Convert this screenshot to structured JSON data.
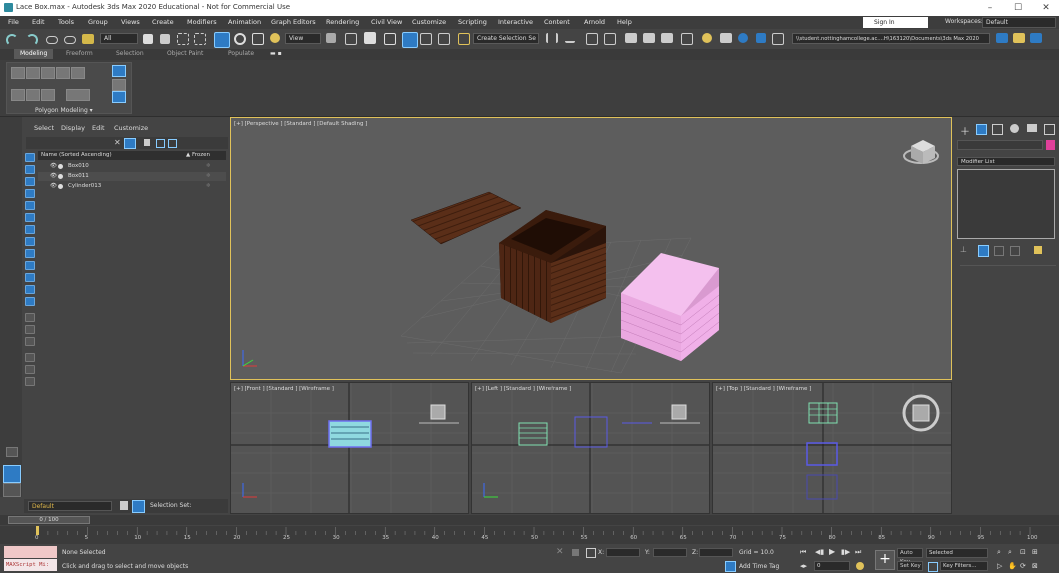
{
  "window": {
    "title": "Lace Box.max - Autodesk 3ds Max 2020 Educational - Not for Commercial Use",
    "min": "–",
    "max": "☐",
    "close": "✕"
  },
  "menu": [
    "File",
    "Edit",
    "Tools",
    "Group",
    "Views",
    "Create",
    "Modifiers",
    "Animation",
    "Graph Editors",
    "Rendering",
    "Civil View",
    "Customize",
    "Scripting",
    "Interactive",
    "Content",
    "Arnold",
    "Help"
  ],
  "account": {
    "signin": "Sign In",
    "workspaces_label": "Workspaces:",
    "workspace": "Default"
  },
  "toolbar": {
    "filter": "All",
    "view": "View",
    "selection_set": "Create Selection Se",
    "path": "\\\\student.nottinghamcollege.ac....H\\163120\\Documents\\3ds Max 2020"
  },
  "ribbon": {
    "tabs": [
      "Modeling",
      "Freeform",
      "Selection",
      "Object Paint",
      "Populate"
    ],
    "panel_label": "Polygon Modeling ▾"
  },
  "explorer": {
    "menu": [
      "Select",
      "Display",
      "Edit",
      "Customize"
    ],
    "col_name": "Name (Sorted Ascending)",
    "col_frozen": "▲ Frozen",
    "rows": [
      {
        "name": "Box010"
      },
      {
        "name": "Box011"
      },
      {
        "name": "Cylinder013"
      }
    ]
  },
  "layer": {
    "name": "Default",
    "selset_label": "Selection Set:"
  },
  "viewports": {
    "perspective": "[+] [Perspective ] [Standard ] [Default Shading ]",
    "front": "[+] [Front ] [Standard ] [Wireframe ]",
    "left": "[+] [Left ] [Standard ] [Wireframe ]",
    "top": "[+] [Top ] [Standard ] [Wireframe ]"
  },
  "cmdpanel": {
    "modifier_list": "Modifier List"
  },
  "timeline": {
    "frame": "0 / 100",
    "ticks": [
      "0",
      "5",
      "10",
      "15",
      "20",
      "25",
      "30",
      "35",
      "40",
      "45",
      "50",
      "55",
      "60",
      "65",
      "70",
      "75",
      "80",
      "85",
      "90",
      "95",
      "100"
    ]
  },
  "status": {
    "maxscript": "MAXScript Mi:",
    "selection": "None Selected",
    "prompt": "Click and drag to select and move objects",
    "x_label": "X:",
    "y_label": "Y:",
    "z_label": "Z:",
    "grid": "Grid = 10.0",
    "add_time_tag": "Add Time Tag",
    "auto_key": "Auto Key",
    "selected": "Selected",
    "set_key": "Set Key",
    "key_filters": "Key Filters...",
    "frame_value": "0"
  },
  "colors": {
    "accent": "#2e7bc4",
    "viewport_border": "#e0c25a",
    "paper": "#f0b0e8",
    "crate": "#5a2e18"
  }
}
